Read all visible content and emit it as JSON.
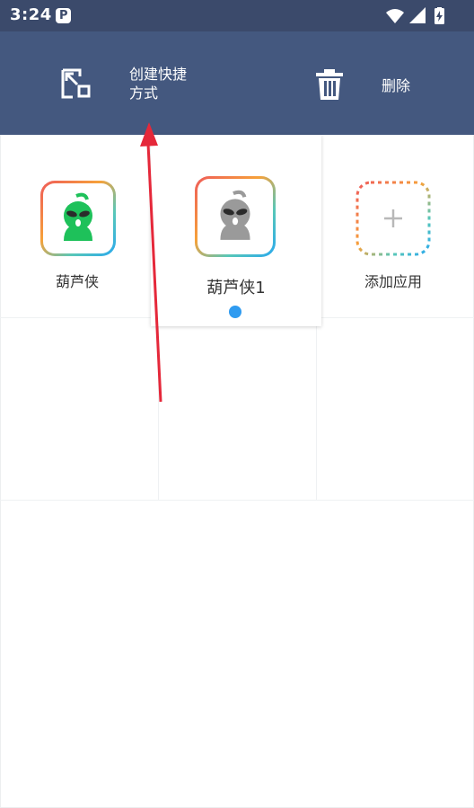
{
  "status_bar": {
    "time": "3:24",
    "notification_icon": "p-icon",
    "system_icons": [
      "wifi-icon",
      "signal-icon",
      "battery-charging-icon"
    ]
  },
  "toolbar": {
    "create_shortcut_line1": "创建快捷",
    "create_shortcut_line2": "方式",
    "delete_label": "删除"
  },
  "apps": [
    {
      "label": "葫芦侠",
      "icon": "huluxia-green-icon"
    },
    {
      "label": "葫芦侠1",
      "icon": "huluxia-gray-icon",
      "dragging": true
    },
    {
      "label": "添加应用",
      "icon": "add-app-icon"
    }
  ],
  "colors": {
    "toolbar_bg": "#44587f",
    "status_bg": "#3b4a6b",
    "accent_dot": "#2f9bf0",
    "annotation_arrow": "#e5283a"
  }
}
